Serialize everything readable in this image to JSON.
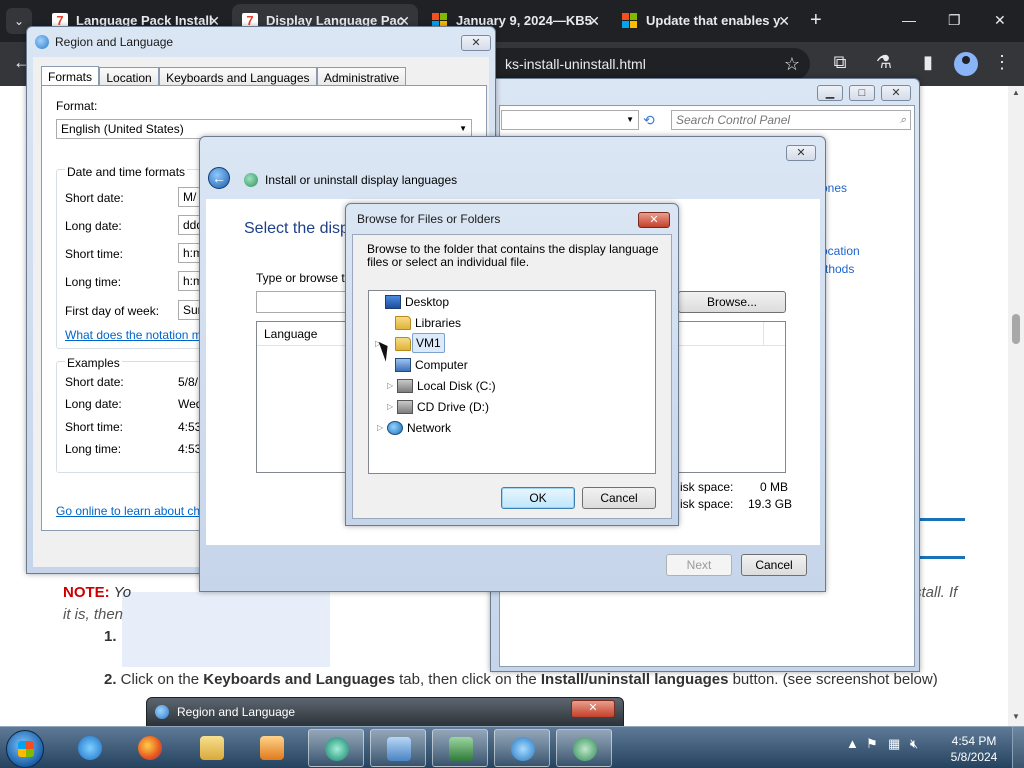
{
  "browser": {
    "tabs": [
      {
        "title": "Language Pack Install",
        "icon": "seven-forums-icon"
      },
      {
        "title": "Display Language Pac",
        "icon": "seven-forums-icon"
      },
      {
        "title": "January 9, 2024—KB5",
        "icon": "microsoft-icon"
      },
      {
        "title": "Update that enables y",
        "icon": "microsoft-icon"
      }
    ],
    "url_fragment": "ks-install-uninstall.html",
    "new_tab": "+",
    "tab_close": "✕"
  },
  "page": {
    "note_label": "NOTE:",
    "note_text": " Yo",
    "note_right": "stall. If",
    "note_line2": "it is, then",
    "step1": "1.",
    "step2_prefix": "2.",
    "step2_a": " Click on the ",
    "step2_b": "Keyboards and Languages",
    "step2_c": " tab, then click on the ",
    "step2_d": "Install/uninstall languages",
    "step2_e": " button. (see screenshot below)"
  },
  "region_window": {
    "title": "Region and Language",
    "tabs": [
      "Formats",
      "Location",
      "Keyboards and Languages",
      "Administrative"
    ],
    "format_label": "Format:",
    "format_value": "English (United States)",
    "dt_group": "Date and time formats",
    "rows": [
      {
        "label": "Short date:",
        "value": "M/"
      },
      {
        "label": "Long date:",
        "value": "ddd"
      },
      {
        "label": "Short time:",
        "value": "h:m"
      },
      {
        "label": "Long time:",
        "value": "h:m"
      },
      {
        "label": "First day of week:",
        "value": "Sun"
      }
    ],
    "notation_link": "What does the notation m",
    "examples_group": "Examples",
    "examples": [
      {
        "label": "Short date:",
        "value": "5/8/"
      },
      {
        "label": "Long date:",
        "value": "Wed"
      },
      {
        "label": "Short time:",
        "value": "4:53"
      },
      {
        "label": "Long time:",
        "value": "4:53"
      }
    ],
    "online_link": "Go online to learn about ch"
  },
  "control_panel": {
    "search_placeholder": "Search Control Panel",
    "link1": "ones",
    "link2": "ocation",
    "link3": "thods"
  },
  "install_wizard": {
    "title": "Install or uninstall display languages",
    "heading": "Select the disp",
    "type_label": "Type or browse t",
    "browse_label": "Browse...",
    "column_language": "Language",
    "disk1_label": "isk space:",
    "disk1_value": "0 MB",
    "disk2_label": "isk space:",
    "disk2_value": "19.3 GB",
    "next_label": "Next",
    "cancel_label": "Cancel"
  },
  "browse_dialog": {
    "title": "Browse for Files or Folders",
    "description": "Browse to the folder that contains the display language files or select an individual file.",
    "tree": [
      {
        "label": "Desktop",
        "icon": "desktop-icon",
        "indent": 0,
        "expander": ""
      },
      {
        "label": "Libraries",
        "icon": "folder-icon",
        "indent": 1,
        "expander": ""
      },
      {
        "label": "VM1",
        "icon": "user-folder-icon",
        "indent": 1,
        "expander": "▷",
        "selected": true
      },
      {
        "label": "Computer",
        "icon": "computer-icon",
        "indent": 1,
        "expander": ""
      },
      {
        "label": "Local Disk (C:)",
        "icon": "local-disk-icon",
        "indent": 2,
        "expander": "▷"
      },
      {
        "label": "CD Drive (D:)",
        "icon": "cd-drive-icon",
        "indent": 2,
        "expander": "▷"
      },
      {
        "label": "Network",
        "icon": "network-icon",
        "indent": 1,
        "expander": "▷"
      }
    ],
    "ok_label": "OK",
    "cancel_label": "Cancel"
  },
  "minimized_window": {
    "title": "Region and Language"
  },
  "taskbar": {
    "time": "4:54 PM",
    "date": "5/8/2024",
    "tray_chevron": "▲"
  }
}
